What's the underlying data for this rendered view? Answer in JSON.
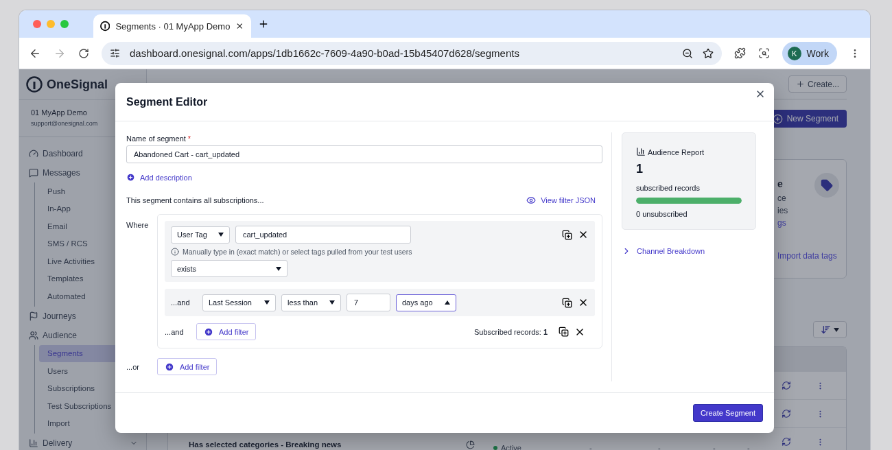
{
  "browser": {
    "tab_title": "Segments · 01 MyApp Demo",
    "url": "dashboard.onesignal.com/apps/1db1662c-7609-4a90-b0ad-15b45407d628/segments",
    "profile": {
      "initial": "K",
      "name": "Work"
    }
  },
  "sidebar": {
    "brand": "OneSignal",
    "app_name": "01 MyApp Demo",
    "email": "support@onesignal.com",
    "items": [
      {
        "label": "Dashboard",
        "selected": false
      },
      {
        "label": "Messages",
        "selected": false,
        "children": [
          {
            "label": "Push",
            "selected": false
          },
          {
            "label": "In-App",
            "selected": false
          },
          {
            "label": "Email",
            "selected": false
          },
          {
            "label": "SMS / RCS",
            "selected": false
          },
          {
            "label": "Live Activities",
            "selected": false
          },
          {
            "label": "Templates",
            "selected": false
          },
          {
            "label": "Automated",
            "selected": false
          }
        ]
      },
      {
        "label": "Journeys",
        "selected": false
      },
      {
        "label": "Audience",
        "selected": false,
        "children": [
          {
            "label": "Segments",
            "selected": true
          },
          {
            "label": "Users",
            "selected": false
          },
          {
            "label": "Subscriptions",
            "selected": false
          },
          {
            "label": "Test Subscriptions",
            "selected": false
          },
          {
            "label": "Import",
            "selected": false
          }
        ]
      },
      {
        "label": "Delivery",
        "selected": false,
        "expanded": false
      }
    ]
  },
  "background": {
    "create_button": "Create...",
    "new_segment_button": "New Segment",
    "card": {
      "lines": [
        "e",
        "ce",
        "ies"
      ],
      "link_fragment": "gs",
      "import_link": "Import data tags"
    },
    "rows": [
      {
        "title": "Has selected categories - Breaking news",
        "status": "Active",
        "cells": [
          "-",
          "-",
          "-",
          "-"
        ]
      }
    ]
  },
  "modal": {
    "title": "Segment Editor",
    "name_label": "Name of segment",
    "name_required_mark": "*",
    "name_value": "Abandoned Cart - cart_updated",
    "add_description": "Add description",
    "contains_text": "This segment contains all subscriptions...",
    "view_json": "View filter JSON",
    "where_label": "Where",
    "filters": [
      {
        "kind": "tag",
        "field": {
          "label": "User Tag",
          "expanded": false
        },
        "key": "cart_updated",
        "hint": "Manually type in (exact match) or select tags pulled from your test users",
        "operator": {
          "label": "exists",
          "expanded": false
        }
      },
      {
        "kind": "session",
        "conjunction": "...and",
        "field": {
          "label": "Last Session",
          "expanded": false
        },
        "operator": {
          "label": "less than",
          "expanded": false
        },
        "value": "7",
        "unit": {
          "label": "days ago",
          "expanded": true
        }
      }
    ],
    "and_row": {
      "conjunction": "...and",
      "button": "Add filter",
      "records": "Subscribed records: **1**"
    },
    "or_row": {
      "conjunction": "...or",
      "button": "Add filter"
    },
    "report": {
      "title": "Audience Report",
      "count": "1",
      "count_label": "subscribed records",
      "level": 1,
      "unsubscribed": "0 unsubscribed"
    },
    "channel_breakdown": {
      "label": "Channel Breakdown",
      "expanded": false
    },
    "submit": "Create Segment"
  }
}
